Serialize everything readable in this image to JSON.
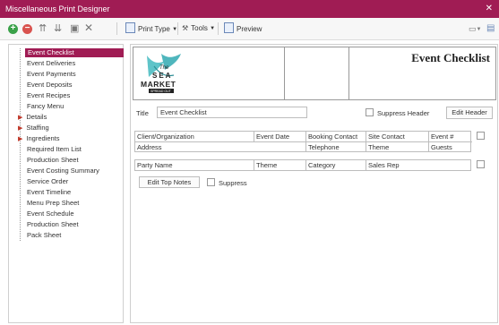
{
  "window": {
    "title": "Miscellaneous Print Designer",
    "close_icon": "close-icon"
  },
  "toolbar": {
    "print_type": "Print Type",
    "tools": "Tools",
    "preview": "Preview"
  },
  "sidebar": {
    "items": [
      {
        "label": "Event Checklist",
        "selected": true
      },
      {
        "label": "Event Deliveries"
      },
      {
        "label": "Event Payments"
      },
      {
        "label": "Event Deposits"
      },
      {
        "label": "Event Recipes"
      },
      {
        "label": "Fancy Menu"
      },
      {
        "label": "Details",
        "expandable": true
      },
      {
        "label": "Staffing",
        "expandable": true
      },
      {
        "label": "Ingredients",
        "expandable": true
      },
      {
        "label": "Required Item List"
      },
      {
        "label": "Production Sheet"
      },
      {
        "label": "Event Costing Summary"
      },
      {
        "label": "Service Order"
      },
      {
        "label": "Event Timeline"
      },
      {
        "label": "Menu Prep Sheet"
      },
      {
        "label": "Event Schedule"
      },
      {
        "label": "Production Sheet"
      },
      {
        "label": "Pack Sheet"
      }
    ]
  },
  "header": {
    "title": "Event Checklist",
    "logo": {
      "line1": "The",
      "line2": "SEA",
      "line3": "MARKET",
      "line4": "SPREAD OUT"
    }
  },
  "form": {
    "title_label": "Title",
    "title_value": "Event Checklist",
    "suppress_header": "Suppress Header",
    "edit_header": "Edit Header",
    "grid1_row1": [
      "Client/Organization",
      "Event Date",
      "Booking Contact",
      "Site Contact",
      "Event #"
    ],
    "grid1_row2": [
      "Address",
      "",
      "Telephone",
      "Theme",
      "Guests"
    ],
    "grid2_row1": [
      "Party Name",
      "Theme",
      "Category",
      "Sales Rep"
    ],
    "edit_top_notes": "Edit Top Notes",
    "suppress": "Suppress"
  },
  "colors": {
    "accent": "#a01c54",
    "selected": "#a01c54",
    "add": "#3aa149",
    "remove": "#d9534f"
  }
}
